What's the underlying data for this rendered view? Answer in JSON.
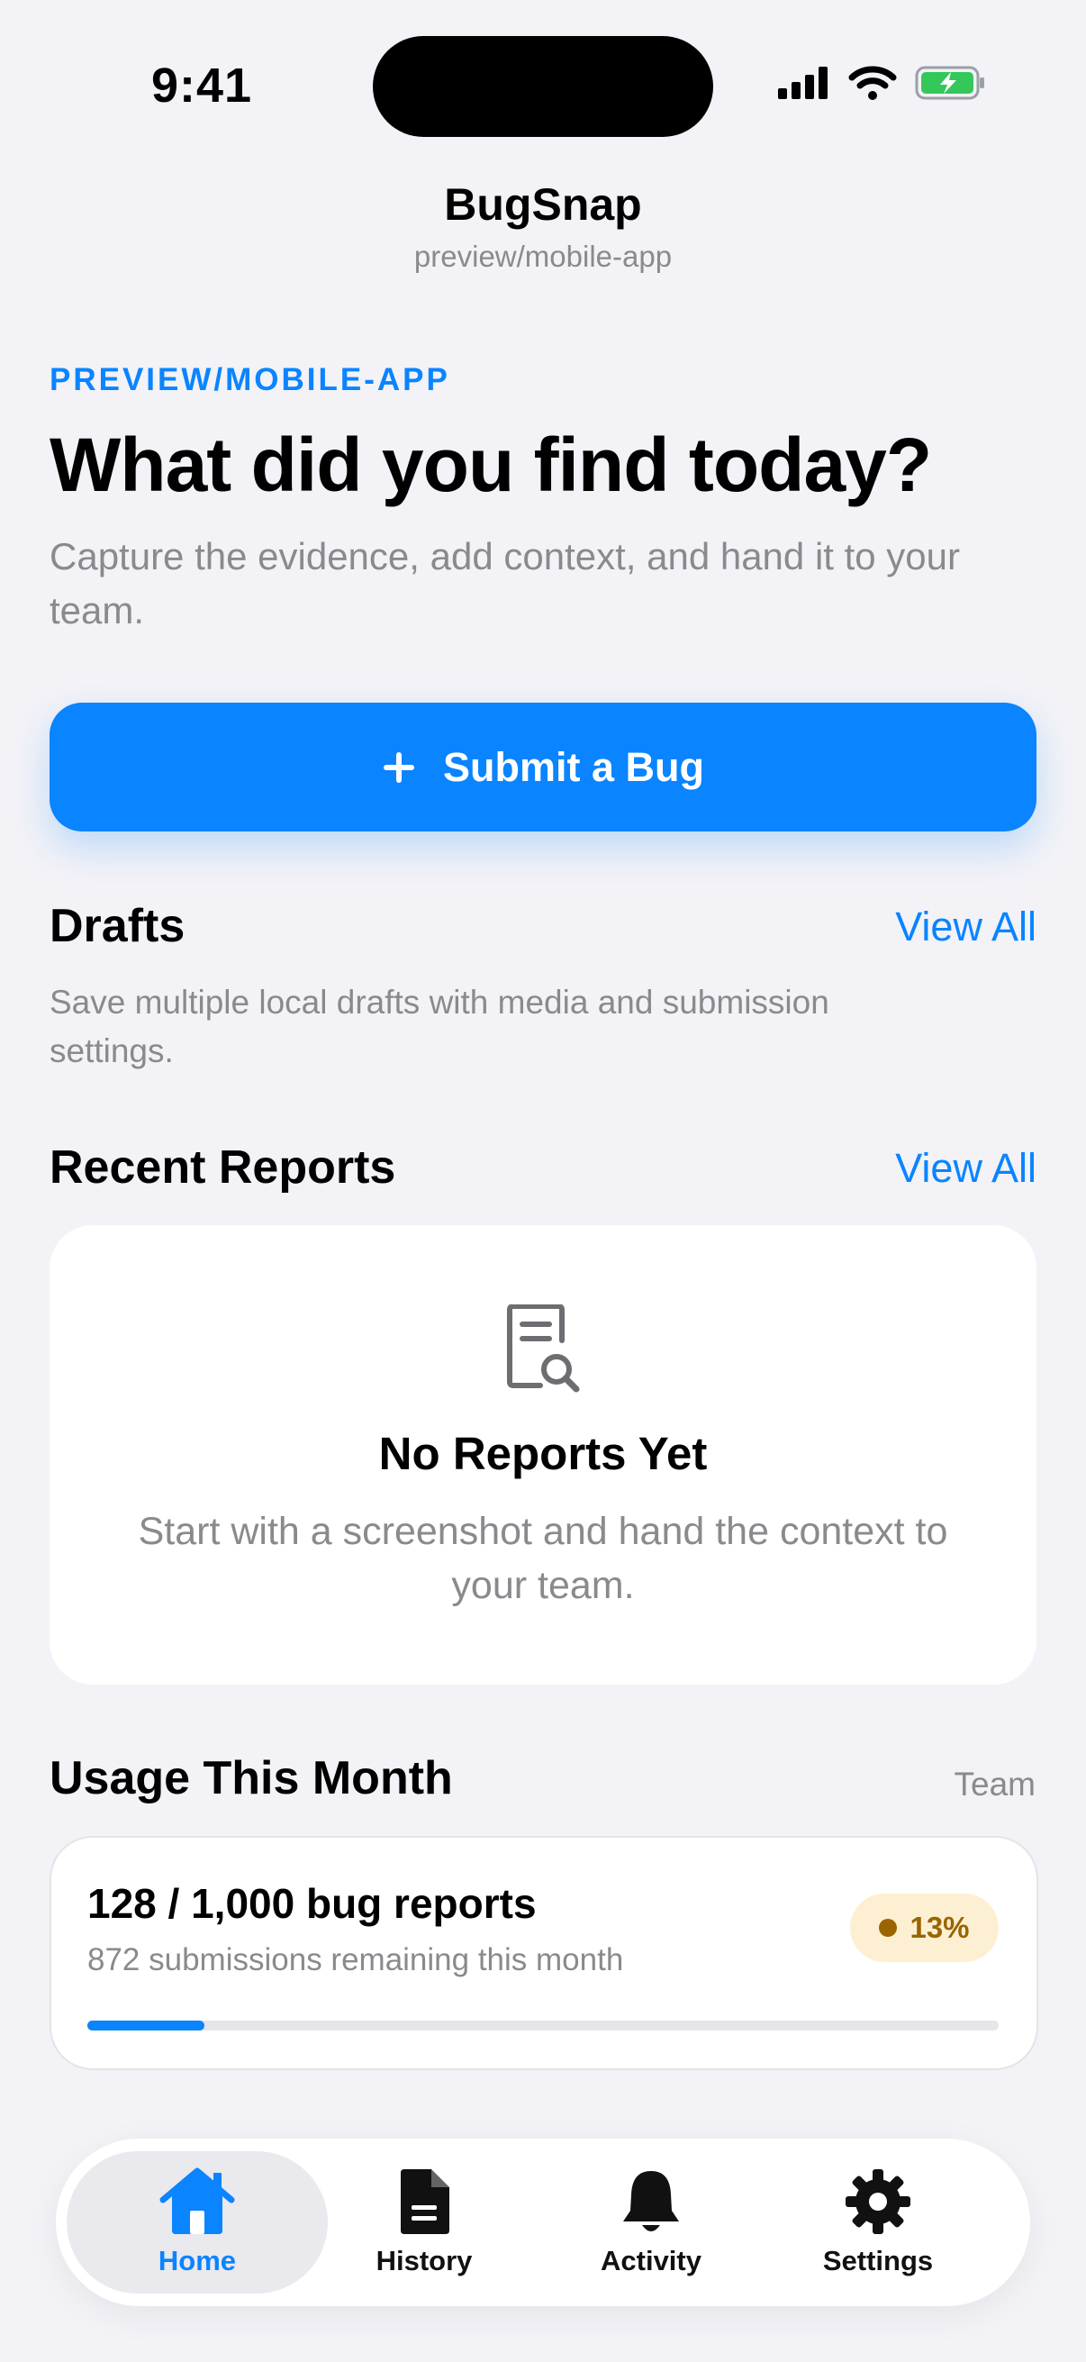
{
  "status_bar": {
    "time": "9:41"
  },
  "header": {
    "title": "BugSnap",
    "subtitle": "preview/mobile-app"
  },
  "hero": {
    "eyebrow": "PREVIEW/MOBILE-APP",
    "title": "What did you find today?",
    "description": "Capture the evidence, add context, and hand it to your team."
  },
  "primary_action": {
    "label": "Submit a Bug",
    "icon": "plus-icon"
  },
  "drafts": {
    "title": "Drafts",
    "view_all": "View All",
    "description": "Save multiple local drafts with media and submission settings."
  },
  "recent_reports": {
    "title": "Recent Reports",
    "view_all": "View All",
    "empty_title": "No Reports Yet",
    "empty_description": "Start with a screenshot and hand the context to your team.",
    "empty_icon": "document-search-icon"
  },
  "usage": {
    "title": "Usage This Month",
    "scope": "Team",
    "main": "128 / 1,000 bug reports",
    "sub": "872 submissions remaining this month",
    "badge": "13%",
    "progress": 0.128,
    "colors": {
      "accent": "#0a84ff",
      "badge_bg": "#fdf0d2",
      "badge_fg": "#9a6400"
    }
  },
  "tab_bar": {
    "active": "Home",
    "tabs": [
      {
        "label": "Home",
        "icon": "house-icon"
      },
      {
        "label": "History",
        "icon": "document-icon"
      },
      {
        "label": "Activity",
        "icon": "bell-icon"
      },
      {
        "label": "Settings",
        "icon": "gear-icon"
      }
    ]
  }
}
